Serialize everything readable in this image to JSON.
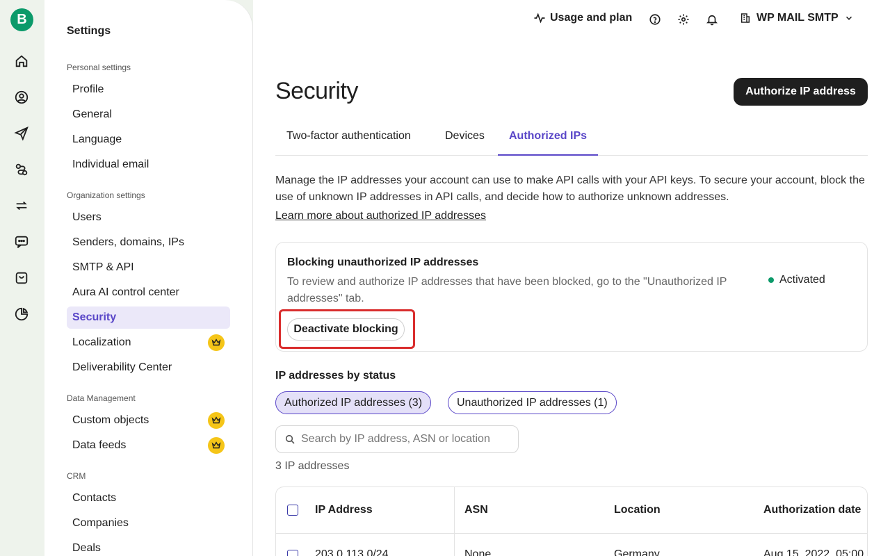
{
  "rail": {
    "logo": "B",
    "icons": [
      "home-icon",
      "contacts-icon",
      "send-icon",
      "automation-icon",
      "conversations-icon",
      "chat-icon",
      "shop-icon",
      "reports-icon"
    ]
  },
  "sidebar": {
    "title": "Settings",
    "personal_label": "Personal settings",
    "personal_items": [
      "Profile",
      "General",
      "Language",
      "Individual email"
    ],
    "org_label": "Organization settings",
    "org_items": [
      "Users",
      "Senders, domains, IPs",
      "SMTP & API",
      "Aura AI control center",
      "Security",
      "Localization",
      "Deliverability Center"
    ],
    "data_label": "Data Management",
    "data_items": [
      "Custom objects",
      "Data feeds"
    ],
    "crm_label": "CRM",
    "crm_items": [
      "Contacts",
      "Companies",
      "Deals"
    ]
  },
  "topbar": {
    "usage": "Usage and plan",
    "org_name": "WP MAIL SMTP"
  },
  "page": {
    "title": "Security",
    "primary_button": "Authorize IP address",
    "tabs": [
      "Two-factor authentication",
      "Devices",
      "Authorized IPs"
    ],
    "description": "Manage the IP addresses your account can use to make API calls with your API keys. To secure your account, block the use of unknown IP addresses in API calls, and decide how to authorize unknown addresses.",
    "learn_more": "Learn more about authorized IP addresses"
  },
  "card": {
    "title": "Blocking unauthorized IP addresses",
    "text": "To review and authorize IP addresses that have been blocked, go to the \"Unauthorized IP addresses\" tab.",
    "status": "Activated",
    "button": "Deactivate blocking"
  },
  "status_section": {
    "heading": "IP addresses by status",
    "chip_authorized": "Authorized IP addresses (3)",
    "chip_unauthorized": "Unauthorized IP addresses (1)",
    "search_placeholder": "Search by IP address, ASN or location",
    "count": "3 IP addresses"
  },
  "table": {
    "headers": [
      "IP Address",
      "ASN",
      "Location",
      "Authorization date"
    ],
    "rows": [
      [
        "203.0.113.0/24",
        "None",
        "Germany",
        "Aug 15, 2022, 05:00"
      ]
    ]
  },
  "colors": {
    "accent": "#5a47c8",
    "brand": "#0b9a6a",
    "highlight": "#d92d2d"
  }
}
